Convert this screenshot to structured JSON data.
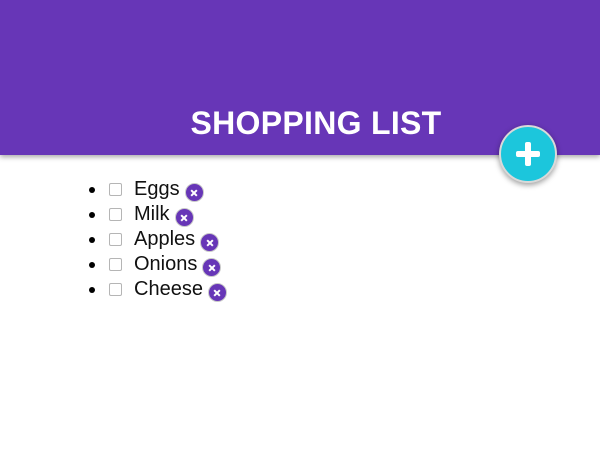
{
  "header": {
    "title": "SHOPPING LIST",
    "color": "#6736b7",
    "add_button_icon": "plus-icon",
    "add_button_color": "#1cc6dc"
  },
  "list": {
    "items": [
      {
        "label": "Eggs",
        "checked": false,
        "delete_icon": "close-icon"
      },
      {
        "label": "Milk",
        "checked": false,
        "delete_icon": "close-icon"
      },
      {
        "label": "Apples",
        "checked": false,
        "delete_icon": "close-icon"
      },
      {
        "label": "Onions",
        "checked": false,
        "delete_icon": "close-icon"
      },
      {
        "label": "Cheese",
        "checked": false,
        "delete_icon": "close-icon"
      }
    ]
  }
}
